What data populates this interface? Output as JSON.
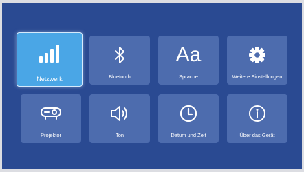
{
  "settings": {
    "tiles": [
      {
        "label": "Netzwerk",
        "icon": "network-signal-icon",
        "selected": true
      },
      {
        "label": "Bluetooth",
        "icon": "bluetooth-icon",
        "selected": false
      },
      {
        "label": "Sprache",
        "icon": "language-icon",
        "icon_text": "Aa",
        "selected": false
      },
      {
        "label": "Weitere Einstellungen",
        "icon": "gear-icon",
        "selected": false
      },
      {
        "label": "Projektor",
        "icon": "projector-icon",
        "selected": false
      },
      {
        "label": "Ton",
        "icon": "speaker-icon",
        "selected": false
      },
      {
        "label": "Datum und Zeit",
        "icon": "clock-icon",
        "selected": false
      },
      {
        "label": "Über das Gerät",
        "icon": "info-icon",
        "selected": false
      }
    ]
  },
  "colors": {
    "background": "#2a4a92",
    "tile": "#4d6cae",
    "tile_selected": "#4aa6e6",
    "text": "#ffffff"
  }
}
